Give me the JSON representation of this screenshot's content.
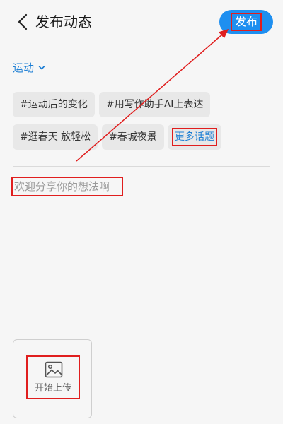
{
  "header": {
    "title": "发布动态",
    "publish_label": "发布"
  },
  "category": {
    "label": "运动"
  },
  "topics": [
    "#运动后的变化",
    "#用写作助手AI上表达",
    "#逛春天 放轻松",
    "#春城夜景"
  ],
  "more_topics_label": "更多话题",
  "post_input": {
    "value": "",
    "placeholder": "欢迎分享你的想法啊"
  },
  "upload": {
    "label": "开始上传"
  },
  "colors": {
    "accent": "#1e8ff0",
    "link": "#1e7fd4",
    "annotation": "#e01e1e"
  },
  "icons": {
    "back": "chevron-left-icon",
    "category": "chevron-down-icon",
    "upload": "image-icon"
  }
}
